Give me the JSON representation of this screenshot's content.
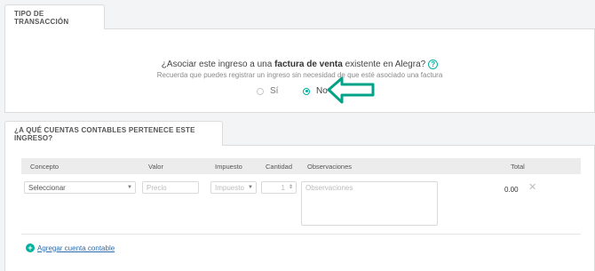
{
  "transaction": {
    "tab_label": "TIPO DE TRANSACCIÓN",
    "question_prefix": "¿Asociar este ingreso a una ",
    "question_bold": "factura de venta",
    "question_suffix": " existente en Alegra?",
    "help_icon": "?",
    "subtext": "Recuerda que puedes registrar un ingreso sin necesidad de que esté asociado una factura",
    "options": [
      {
        "label": "Sí",
        "checked": false
      },
      {
        "label": "No",
        "checked": true
      }
    ]
  },
  "accounts": {
    "tab_label": "¿A QUÉ CUENTAS CONTABLES PERTENECE ESTE INGRESO?",
    "columns": [
      "Concepto",
      "Valor",
      "Impuesto",
      "Cantidad",
      "Observaciones",
      "Total"
    ],
    "row": {
      "concepto": "Seleccionar",
      "valor_placeholder": "Precio",
      "impuesto": "Impuesto",
      "cantidad": "1",
      "observaciones_placeholder": "Observaciones",
      "total": "0.00"
    },
    "add_link": "Agregar cuenta contable"
  },
  "colors": {
    "accent": "#00b19d",
    "link": "#2b6cb0",
    "arrow": "#00a388"
  }
}
